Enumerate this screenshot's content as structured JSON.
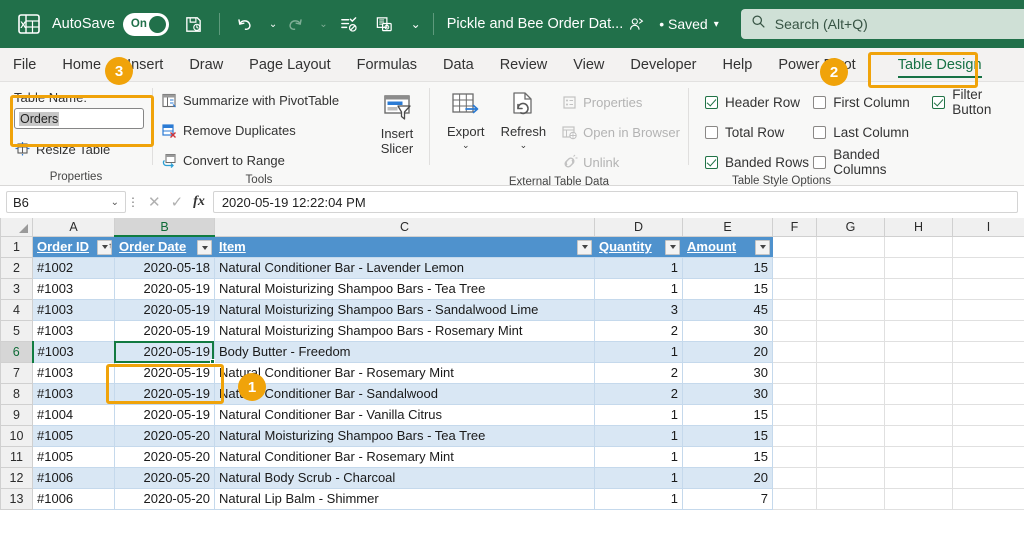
{
  "titlebar": {
    "app_icon": "excel-logo-icon",
    "autosave_label": "AutoSave",
    "autosave_state": "On",
    "save_icon": "save-icon",
    "undo_icon": "undo-icon",
    "redo_icon": "redo-icon",
    "touch_icon": "edit-list-icon",
    "customize_icon": "camera-icon",
    "more_icon": "more-chevron-icon",
    "document_title": "Pickle and Bee Order Dat...",
    "share_icon": "person-share-icon",
    "saved_status": "• Saved",
    "saved_caret": "▾",
    "search_icon": "search-icon",
    "search_placeholder": "Search (Alt+Q)"
  },
  "tabs": [
    {
      "label": "File",
      "active": false
    },
    {
      "label": "Home",
      "active": false
    },
    {
      "label": "Insert",
      "active": false
    },
    {
      "label": "Draw",
      "active": false
    },
    {
      "label": "Page Layout",
      "active": false
    },
    {
      "label": "Formulas",
      "active": false
    },
    {
      "label": "Data",
      "active": false
    },
    {
      "label": "Review",
      "active": false
    },
    {
      "label": "View",
      "active": false
    },
    {
      "label": "Developer",
      "active": false
    },
    {
      "label": "Help",
      "active": false
    },
    {
      "label": "Power Pivot",
      "active": false
    },
    {
      "label": "Table Design",
      "active": true
    }
  ],
  "ribbon": {
    "properties": {
      "caption": "Properties",
      "table_name_label": "Table Name:",
      "table_name_value": "Orders",
      "resize_table_label": "Resize Table",
      "resize_icon": "resize-table-icon"
    },
    "tools": {
      "caption": "Tools",
      "summarize_label": "Summarize with PivotTable",
      "summarize_icon": "pivottable-icon",
      "remove_duplicates_label": "Remove Duplicates",
      "remove_duplicates_icon": "remove-duplicates-icon",
      "convert_range_label": "Convert to Range",
      "convert_range_icon": "convert-to-range-icon",
      "insert_slicer_label_line1": "Insert",
      "insert_slicer_label_line2": "Slicer",
      "insert_slicer_icon": "slicer-icon"
    },
    "external_table_data": {
      "caption": "External Table Data",
      "export_label": "Export",
      "export_icon": "export-icon",
      "export_caret": "⌄",
      "refresh_label": "Refresh",
      "refresh_icon": "refresh-icon",
      "refresh_caret": "⌄",
      "properties_label": "Properties",
      "properties_icon": "properties-icon",
      "open_browser_label": "Open in Browser",
      "open_browser_icon": "open-in-browser-icon",
      "unlink_label": "Unlink",
      "unlink_icon": "unlink-icon"
    },
    "table_style_options": {
      "caption": "Table Style Options",
      "items": [
        {
          "label": "Header Row",
          "checked": true
        },
        {
          "label": "Total Row",
          "checked": false
        },
        {
          "label": "Banded Rows",
          "checked": true
        },
        {
          "label": "First Column",
          "checked": false
        },
        {
          "label": "Last Column",
          "checked": false
        },
        {
          "label": "Banded Columns",
          "checked": false
        },
        {
          "label": "Filter Button",
          "checked": true
        }
      ]
    }
  },
  "formula_bar": {
    "name_box_value": "B6",
    "name_box_caret": "⌄",
    "expand_dots": "⋮",
    "cancel_icon": "cancel-x-icon",
    "enter_icon": "confirm-check-icon",
    "function_icon": "fx-icon",
    "formula_value": "2020-05-19  12:22:04 PM"
  },
  "grid": {
    "column_letters": [
      "A",
      "B",
      "C",
      "D",
      "E",
      "F",
      "G",
      "H",
      "I"
    ],
    "selected_column": "B",
    "selected_row": "6",
    "active_cell": "B6",
    "row_numbers": [
      "1",
      "2",
      "3",
      "4",
      "5",
      "6",
      "7",
      "8",
      "9",
      "10",
      "11",
      "12",
      "13"
    ],
    "headers": [
      "Order ID",
      "Order Date",
      "Item",
      "Quantity",
      "Amount"
    ],
    "rows": [
      {
        "order_id": "#1002",
        "order_date": "2020-05-18",
        "item": "Natural Conditioner Bar - Lavender Lemon",
        "quantity": "1",
        "amount": "15"
      },
      {
        "order_id": "#1003",
        "order_date": "2020-05-19",
        "item": "Natural Moisturizing Shampoo Bars - Tea Tree",
        "quantity": "1",
        "amount": "15"
      },
      {
        "order_id": "#1003",
        "order_date": "2020-05-19",
        "item": "Natural Moisturizing Shampoo Bars - Sandalwood Lime",
        "quantity": "3",
        "amount": "45"
      },
      {
        "order_id": "#1003",
        "order_date": "2020-05-19",
        "item": "Natural Moisturizing Shampoo Bars - Rosemary Mint",
        "quantity": "2",
        "amount": "30"
      },
      {
        "order_id": "#1003",
        "order_date": "2020-05-19",
        "item": "Body Butter - Freedom",
        "quantity": "1",
        "amount": "20"
      },
      {
        "order_id": "#1003",
        "order_date": "2020-05-19",
        "item": "Natural Conditioner Bar - Rosemary Mint",
        "quantity": "2",
        "amount": "30"
      },
      {
        "order_id": "#1003",
        "order_date": "2020-05-19",
        "item": "Natural Conditioner Bar - Sandalwood",
        "quantity": "2",
        "amount": "30"
      },
      {
        "order_id": "#1004",
        "order_date": "2020-05-19",
        "item": "Natural Conditioner Bar - Vanilla Citrus",
        "quantity": "1",
        "amount": "15"
      },
      {
        "order_id": "#1005",
        "order_date": "2020-05-20",
        "item": "Natural Moisturizing Shampoo Bars - Tea Tree",
        "quantity": "1",
        "amount": "15"
      },
      {
        "order_id": "#1005",
        "order_date": "2020-05-20",
        "item": "Natural Conditioner Bar - Rosemary Mint",
        "quantity": "1",
        "amount": "15"
      },
      {
        "order_id": "#1006",
        "order_date": "2020-05-20",
        "item": "Natural Body Scrub - Charcoal",
        "quantity": "1",
        "amount": "20"
      },
      {
        "order_id": "#1006",
        "order_date": "2020-05-20",
        "item": "Natural Lip Balm - Shimmer",
        "quantity": "1",
        "amount": "7"
      }
    ]
  },
  "annotations": {
    "badge_1": "1",
    "badge_2": "2",
    "badge_3": "3",
    "highlight_color": "#f0a30a"
  },
  "colors": {
    "titlebar_green": "#21704a",
    "accent_green": "#177245",
    "table_header_blue": "#4f92cd",
    "banded_row_blue": "#d9e7f4",
    "annotation_orange": "#f0a30a"
  }
}
